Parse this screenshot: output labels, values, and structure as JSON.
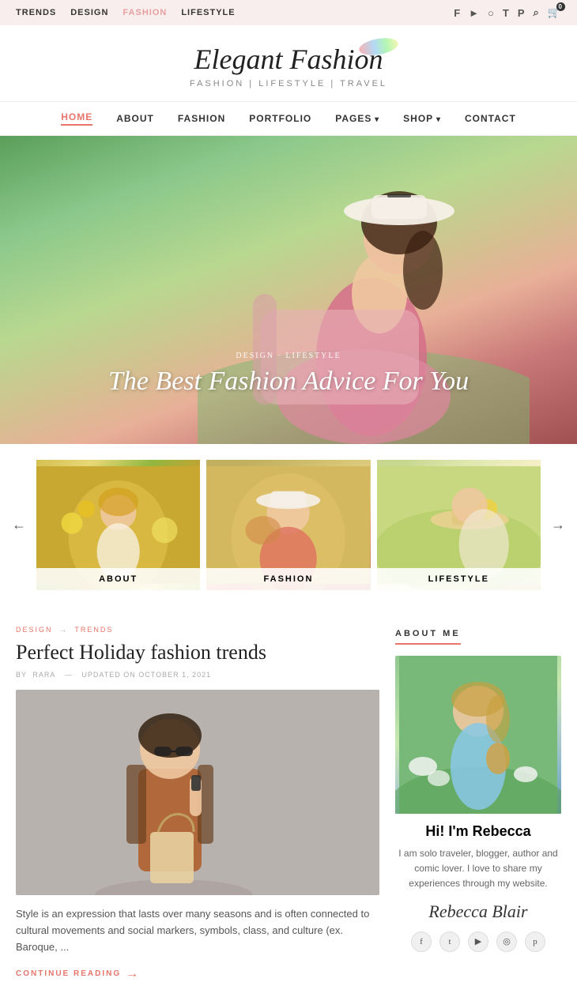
{
  "topbar": {
    "nav": [
      "TRENDS",
      "DESIGN",
      "FASHION",
      "LIFESTYLE"
    ],
    "active_nav": "FASHION"
  },
  "logo": {
    "title": "Elegant Fashion",
    "subtitle": "FASHION | LIFESTYLE | TRAVEL"
  },
  "mainnav": {
    "items": [
      {
        "label": "HOME",
        "active": true
      },
      {
        "label": "ABOUT",
        "active": false
      },
      {
        "label": "FASHION",
        "active": false
      },
      {
        "label": "PORTFOLIO",
        "active": false
      },
      {
        "label": "PAGES",
        "active": false,
        "has_arrow": true
      },
      {
        "label": "SHOP",
        "active": false,
        "has_arrow": true
      },
      {
        "label": "CONTACT",
        "active": false
      }
    ]
  },
  "hero": {
    "categories": "DESIGN · LIFESTYLE",
    "title": "The Best Fashion Advice For You"
  },
  "category_slider": {
    "items": [
      {
        "label": "ABOUT"
      },
      {
        "label": "FASHION"
      },
      {
        "label": "LIFESTYLE"
      }
    ]
  },
  "blog_post": {
    "categories": [
      "DESIGN",
      "TRENDS"
    ],
    "title": "Perfect Holiday fashion trends",
    "author": "RARA",
    "updated": "UPDATED ON OCTOBER 1, 2021",
    "excerpt": "Style is an expression that lasts over many seasons and is often connected to cultural movements and social markers, symbols, class, and culture (ex. Baroque, ...",
    "continue_label": "CONTINUE READING"
  },
  "sidebar": {
    "about_title": "ABOUT ME",
    "name": "Hi! I'm Rebecca",
    "description": "I am solo traveler, blogger, author and comic lover. I love to share my experiences through my website.",
    "signature": "Rebecca Blair",
    "social": [
      "f",
      "t",
      "▶",
      "◉",
      "♦"
    ]
  }
}
